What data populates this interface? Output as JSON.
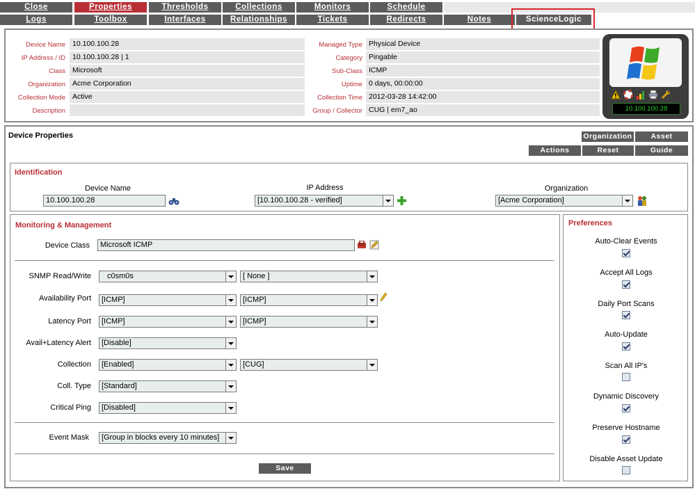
{
  "tabs_row1": [
    {
      "label": "Close",
      "active": false
    },
    {
      "label": "Properties",
      "active": true
    },
    {
      "label": "Thresholds",
      "active": false
    },
    {
      "label": "Collections",
      "active": false
    },
    {
      "label": "Monitors",
      "active": false
    },
    {
      "label": "Schedule",
      "active": false
    }
  ],
  "tabs_row2": [
    {
      "label": "Logs"
    },
    {
      "label": "Toolbox"
    },
    {
      "label": "Interfaces"
    },
    {
      "label": "Relationships"
    },
    {
      "label": "Tickets"
    },
    {
      "label": "Redirects"
    },
    {
      "label": "Notes"
    },
    {
      "label": "ScienceLogic"
    }
  ],
  "device_info": {
    "left": [
      {
        "label": "Device Name",
        "value": "10.100.100.28"
      },
      {
        "label": "IP Address / ID",
        "value": "10.100.100.28 | 1"
      },
      {
        "label": "Class",
        "value": "Microsoft"
      },
      {
        "label": "Organization",
        "value": "Acme Corporation"
      },
      {
        "label": "Collection Mode",
        "value": "Active"
      },
      {
        "label": "Description",
        "value": ""
      }
    ],
    "right": [
      {
        "label": "Managed Type",
        "value": "Physical Device"
      },
      {
        "label": "Category",
        "value": "Pingable"
      },
      {
        "label": "Sub-Class",
        "value": "ICMP"
      },
      {
        "label": "Uptime",
        "value": "0 days, 00:00:00"
      },
      {
        "label": "Collection Time",
        "value": "2012-03-28 14:42:00"
      },
      {
        "label": "Group / Collector",
        "value": "CUG | em7_ao"
      }
    ],
    "device_badge": "10.100.100.28"
  },
  "device_properties": {
    "title": "Device Properties",
    "buttons_row1": [
      "Organization",
      "Asset"
    ],
    "buttons_row2": [
      "Actions",
      "Reset",
      "Guide"
    ]
  },
  "identification": {
    "title": "Identification",
    "device_name_label": "Device Name",
    "device_name_value": "10.100.100.28",
    "ip_label": "IP Address",
    "ip_value": "[10.100.100.28 - verified]",
    "org_label": "Organization",
    "org_value": "[Acme Corporation]"
  },
  "monitoring": {
    "title": "Monitoring & Management",
    "device_class_label": "Device Class",
    "device_class_value": "Microsoft ICMP",
    "snmp_label": "SNMP Read/Write",
    "snmp_read": "c0sm0s",
    "snmp_write": "[ None ]",
    "avail_label": "Availability Port",
    "avail_1": "[ICMP]",
    "avail_2": "[ICMP]",
    "latency_label": "Latency Port",
    "latency_1": "[ICMP]",
    "latency_2": "[ICMP]",
    "alert_label": "Avail+Latency Alert",
    "alert_value": "[Disable]",
    "collection_label": "Collection",
    "collection_1": "[Enabled]",
    "collection_2": "[CUG]",
    "colltype_label": "Coll. Type",
    "colltype_value": "[Standard]",
    "ping_label": "Critical Ping",
    "ping_value": "[Disabled]",
    "eventmask_label": "Event Mask",
    "eventmask_value": "[Group in blocks every 10 minutes]",
    "save_label": "Save"
  },
  "preferences": {
    "title": "Preferences",
    "items": [
      {
        "label": "Auto-Clear Events",
        "checked": true
      },
      {
        "label": "Accept All Logs",
        "checked": true
      },
      {
        "label": "Daily Port Scans",
        "checked": true
      },
      {
        "label": "Auto-Update",
        "checked": true
      },
      {
        "label": "Scan All IP's",
        "checked": false
      },
      {
        "label": "Dynamic Discovery",
        "checked": true
      },
      {
        "label": "Preserve Hostname",
        "checked": true
      },
      {
        "label": "Disable Asset Update",
        "checked": false
      }
    ]
  }
}
